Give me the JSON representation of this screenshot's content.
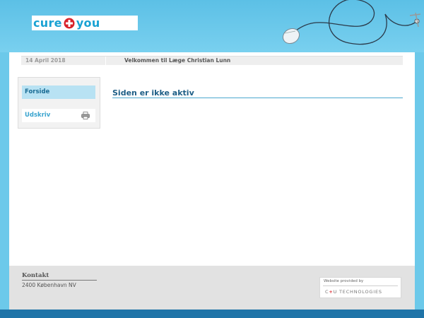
{
  "brand": {
    "logo_left": "cure",
    "logo_right": "you",
    "logo_accent": "#d8232a",
    "logo_color": "#1aa2d3"
  },
  "topbar": {
    "date": "14 April 2018",
    "welcome": "Velkommen til Læge Christian Lunn"
  },
  "sidebar": {
    "items": [
      {
        "label": "Forside",
        "active": true
      },
      {
        "label": "Udskriv",
        "icon": "printer-icon"
      }
    ]
  },
  "main": {
    "title": "Siden er ikke aktiv"
  },
  "footer": {
    "contact_heading": "Kontakt",
    "address": "2400 København NV",
    "provider_label": "Website provided by",
    "provider_name_prefix": "C",
    "provider_name_accent": "+",
    "provider_name_suffix": "U TECHNOLOGIES"
  },
  "colors": {
    "background": "#6cc9ea",
    "accent": "#1e5e86",
    "nav_active": "#b8e2f3",
    "bottom_strip": "#1f74a8"
  }
}
